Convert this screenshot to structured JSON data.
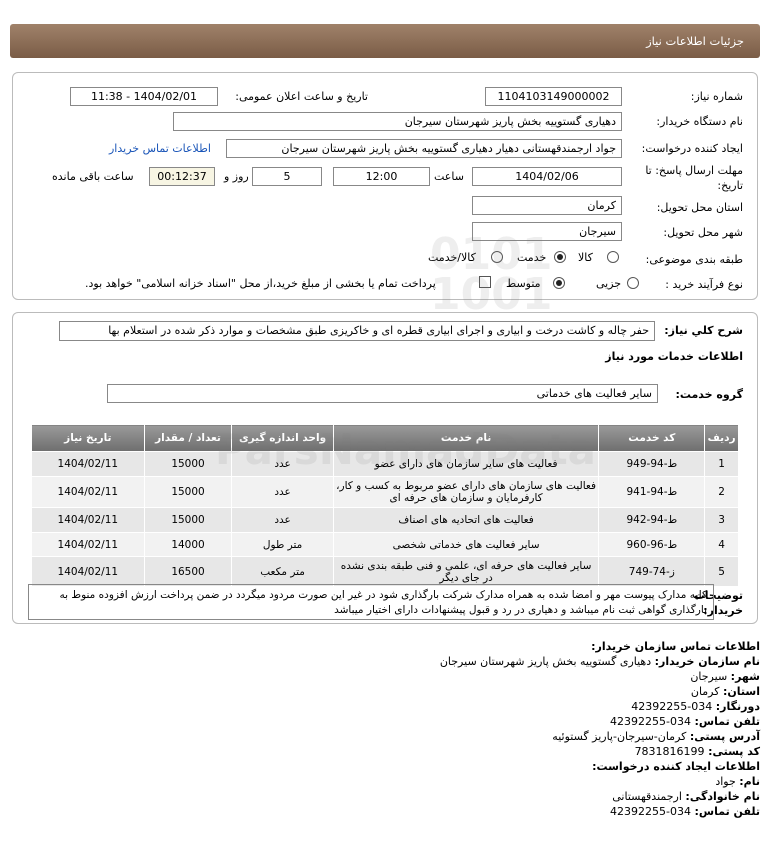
{
  "header": {
    "title": "جزئیات اطلاعات نیاز"
  },
  "form": {
    "need_number_label": "شماره نیاز:",
    "need_number": "1104103149000002",
    "announce_label": "تاریخ و ساعت اعلان عمومی:",
    "announce_value": "1404/02/01 - 11:38",
    "buyer_org_label": "نام دستگاه خریدار:",
    "buyer_org": "دهیاری گستوییه بخش پاریز شهرستان سیرجان",
    "creator_label": "ایجاد کننده درخواست:",
    "creator": "جواد ارجمندقهستانی دهیار دهیاری گستوییه بخش پاریز شهرستان سیرجان",
    "buyer_contact_link": "اطلاعات تماس خریدار",
    "deadline_label_line1": "مهلت ارسال پاسخ: تا",
    "deadline_label_line2": "تاریخ:",
    "deadline_date": "1404/02/06",
    "time_label": "ساعت",
    "deadline_time": "12:00",
    "days_value": "5",
    "days_label": "روز و",
    "remaining_time": "00:12:37",
    "remaining_label": "ساعت باقی مانده",
    "province_label": "استان محل تحویل:",
    "province": "کرمان",
    "city_label": "شهر محل تحویل:",
    "city": "سیرجان",
    "category_label": "طبقه بندی موضوعی:",
    "category_options": [
      "کالا",
      "خدمت",
      "کالا/خدمت"
    ],
    "category_selected": "خدمت",
    "process_label": "نوع فرآیند خرید :",
    "process_options": [
      "جزیی",
      "متوسط"
    ],
    "process_selected": "متوسط",
    "payment_note": "پرداخت تمام یا بخشی از مبلغ خرید،از محل \"اسناد خزانه اسلامی\" خواهد بود."
  },
  "details": {
    "summary_label": "شرح کلي نياز:",
    "summary": "حفر چاله و کاشت درخت و ابیاری و اجرای ابیاری قطره ای و خاکریزی طبق مشخصات و موارد ذکر شده در استعلام بها",
    "services_heading": "اطلاعات خدمات مورد نياز",
    "service_group_label": "گروه خدمت:",
    "service_group": "سایر فعالیت های خدماتی",
    "table": {
      "headers": [
        "ردیف",
        "کد خدمت",
        "نام خدمت",
        "واحد اندازه گیری",
        "تعداد / مقدار",
        "تاریخ نیاز"
      ],
      "rows": [
        [
          "1",
          "ط-94-949",
          "فعالیت های سایر سازمان های دارای عضو",
          "عدد",
          "15000",
          "1404/02/11"
        ],
        [
          "2",
          "ط-94-941",
          "فعالیت های سازمان های دارای عضو مربوط به کسب و کار، کارفرمایان و سازمان های حرفه ای",
          "عدد",
          "15000",
          "1404/02/11"
        ],
        [
          "3",
          "ط-94-942",
          "فعالیت های اتحادیه های اصناف",
          "عدد",
          "15000",
          "1404/02/11"
        ],
        [
          "4",
          "ط-96-960",
          "سایر فعالیت های خدماتی شخصی",
          "متر طول",
          "14000",
          "1404/02/11"
        ],
        [
          "5",
          "ز-74-749",
          "سایر فعالیت های حرفه ای، علمی و فنی طبقه بندی نشده در جای دیگر",
          "متر مکعب",
          "16500",
          "1404/02/11"
        ]
      ]
    },
    "notes_label_1": "توضیحات",
    "notes_label_2": "خریدار:",
    "notes": "کلیه مدارک پیوست مهر و امضا شده به همراه مدارک شرکت بارگذاری شود در غیر این صورت مردود میگردد در ضمن پرداخت ارزش افزوده منوط به بارگذاری گواهی ثبت نام میباشد و دهیاری در رد و قبول پیشنهادات دارای اختیار میباشد"
  },
  "contact": {
    "heading": "اطلاعات تماس سازمان خریدار:",
    "org_label": "نام سازمان خریدار:",
    "org": "دهیاری گستوییه بخش پاریز شهرستان سیرجان",
    "city_label": "شهر:",
    "city": "سیرجان",
    "province_label": "استان:",
    "province": "کرمان",
    "fax_label": "دورنگار:",
    "fax": "034-42392255",
    "phone_label": "تلفن تماس:",
    "phone": "034-42392255",
    "address_label": "آدرس پستی:",
    "address": "کرمان-سیرجان-پاریز گستوئیه",
    "postal_label": "کد پستی:",
    "postal": "7831816199",
    "creator_heading": "اطلاعات ایجاد کننده درخواست:",
    "name_label": "نام:",
    "name": "جواد",
    "family_label": "نام خانوادگی:",
    "family": "ارجمندقهستانی",
    "creator_phone_label": "تلفن تماس:",
    "creator_phone": "034-42392255"
  }
}
